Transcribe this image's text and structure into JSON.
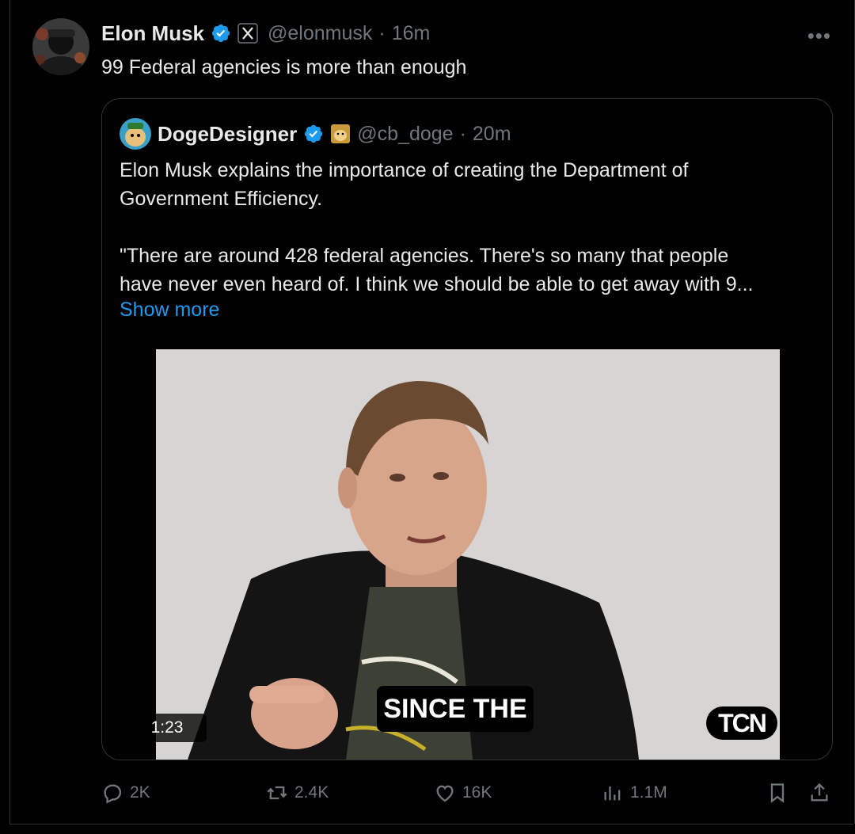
{
  "tweet": {
    "author_name": "Elon Musk",
    "handle": "@elonmusk",
    "time": "16m",
    "separator": "·",
    "more_label": "•••",
    "text": "99 Federal agencies is more than enough"
  },
  "quote": {
    "author_name": "DogeDesigner",
    "handle": "@cb_doge",
    "time": "20m",
    "separator": "·",
    "text": "Elon Musk explains the importance of creating the Department of\nGovernment Efficiency.\n\n\"There are around 428 federal agencies. There's so many that people\nhave never even heard of. I think we should be able to get away with 9...",
    "show_more": "Show more",
    "video": {
      "duration": "1:23",
      "caption": "SINCE THE",
      "logo": "TCN"
    }
  },
  "actions": {
    "replies": "2K",
    "reposts": "2.4K",
    "likes": "16K",
    "views": "1.1M"
  },
  "colors": {
    "accent": "#1d9bf0",
    "muted": "#71767b",
    "text": "#e7e9ea",
    "background": "#000000"
  }
}
